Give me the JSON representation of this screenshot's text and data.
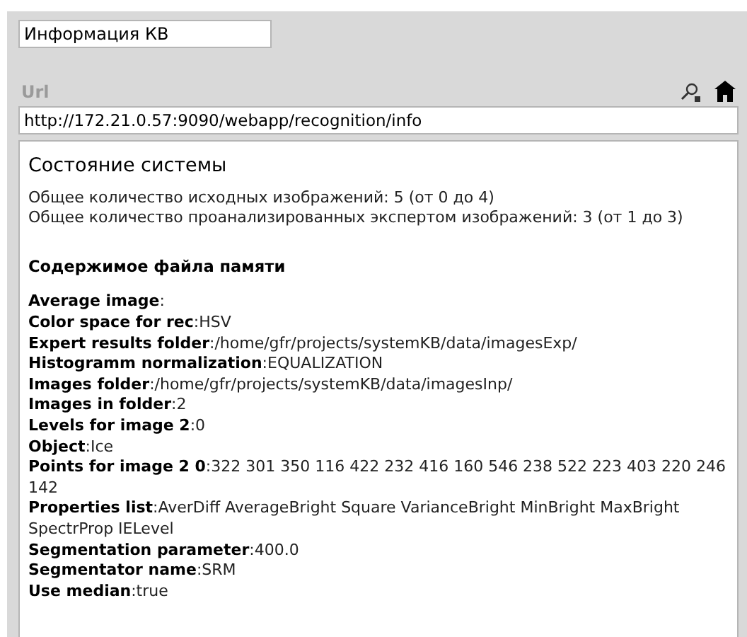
{
  "title_field": {
    "value": "Информация КВ"
  },
  "url": {
    "label": "Url",
    "value": "http://172.21.0.57:9090/webapp/recognition/info"
  },
  "content": {
    "heading": "Состояние системы",
    "status_lines": [
      "Общее количество исходных изображений: 5 (от 0 до 4)",
      "Общее количество проанализированных экспертом изображений: 3 (от 1 до 3)"
    ],
    "section_title": "Содержимое файла памяти",
    "properties": [
      {
        "text": "**Average image**:"
      },
      {
        "text": "**Color space for rec**:HSV"
      },
      {
        "text": "**Expert results folder**:/home/gfr/projects/systemKB/data/imagesExp/"
      },
      {
        "text": "**Histogramm normalization**:EQUALIZATION"
      },
      {
        "text": "**Images folder**:/home/gfr/projects/systemKB/data/imagesInp/"
      },
      {
        "text": "**Images in folder**:2"
      },
      {
        "text": "**Levels for image 2**:0"
      },
      {
        "text": "**Object**:Ice"
      },
      {
        "text": "**Points for image 2 0**:322 301 350 116 422 232 416 160 546 238 522 223 403 220 246 142"
      },
      {
        "text": "**Properties list**:AverDiff AverageBright Square VarianceBright MinBright MaxBright SpectrProp IELevel"
      },
      {
        "text": "**Segmentation parameter**:400.0"
      },
      {
        "text": "**Segmentator name**:SRM"
      },
      {
        "text": "**Use median**:true"
      }
    ]
  }
}
